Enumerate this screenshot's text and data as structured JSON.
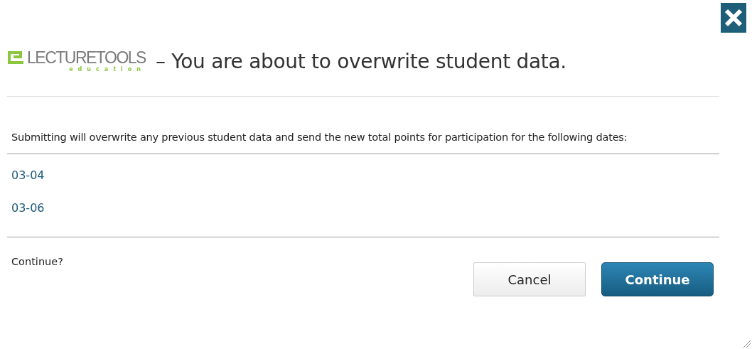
{
  "logo": {
    "name": "LECTURETOOLS",
    "tagline": "education"
  },
  "title": "– You are about to overwrite student data.",
  "message": "Submitting will overwrite any previous student data and send the new total points for participation for the following dates:",
  "dates": [
    "03-04",
    "03-06"
  ],
  "prompt": "Continue?",
  "buttons": [
    {
      "label": "Cancel",
      "kind": "secondary"
    },
    {
      "label": "Continue",
      "kind": "primary"
    }
  ]
}
